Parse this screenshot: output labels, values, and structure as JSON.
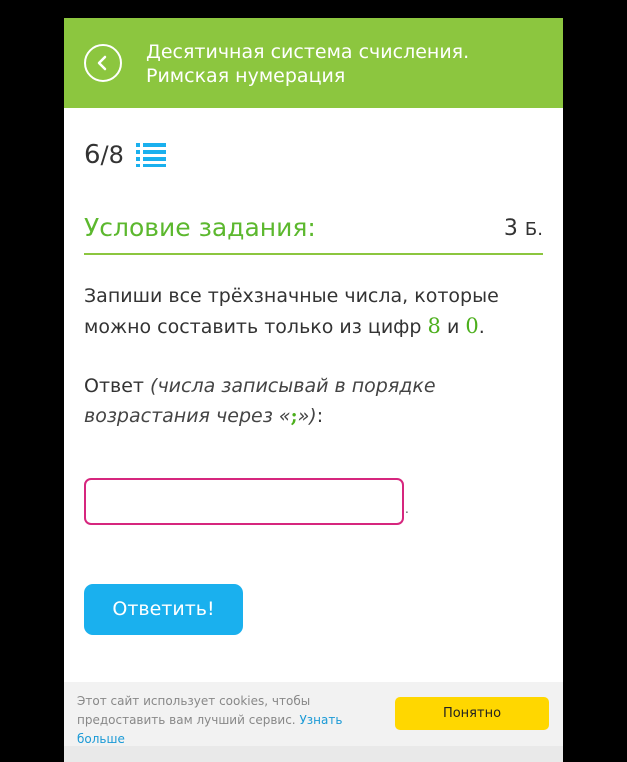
{
  "header": {
    "title": "Десятичная система счисления. Римская нумерация",
    "back_icon": "chevron-left-icon",
    "color": "#8cc63f"
  },
  "progress": {
    "current": "6",
    "total": "/8",
    "icon": "list-icon"
  },
  "condition": {
    "title": "Условие задания:",
    "points_value": "3",
    "points_unit": "Б."
  },
  "task": {
    "text_before": "Запиши все трёхзначные числа, которые можно составить только из цифр",
    "digit1": "8",
    "conj": "и",
    "digit2": "0",
    "end": "."
  },
  "answer": {
    "label": "Ответ",
    "hint_prefix": "(числа записывай в порядке возрастания через «",
    "separator": ";",
    "hint_suffix": "»)",
    "colon": ":",
    "input_value": "",
    "after_input": "."
  },
  "submit": {
    "label": "Ответить!",
    "color": "#1ab0ee"
  },
  "cookie": {
    "text": "Этот сайт использует cookies, чтобы предоставить вам лучший сервис.",
    "link": "Узнать больше",
    "button": "Понятно",
    "button_color": "#ffd700"
  }
}
